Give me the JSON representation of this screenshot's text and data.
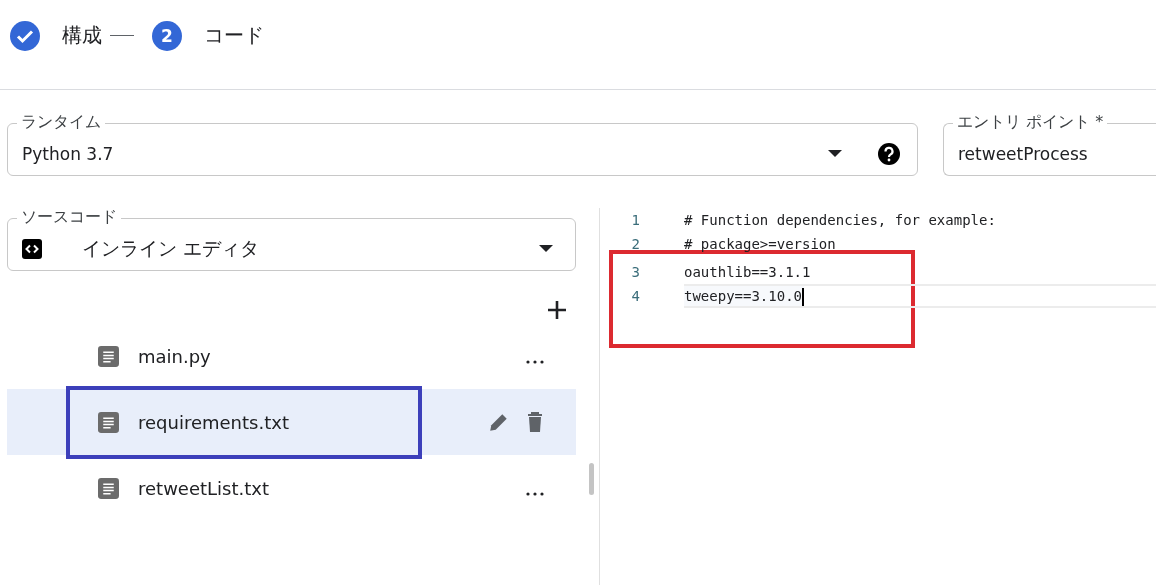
{
  "stepper": [
    {
      "label": "構成",
      "done": true
    },
    {
      "label": "コード",
      "done": false,
      "number": "2"
    }
  ],
  "runtime": {
    "label": "ランタイム",
    "value": "Python 3.7"
  },
  "entry_point": {
    "label": "エントリ ポイント *",
    "value": "retweetProcess"
  },
  "source_code": {
    "label": "ソースコード",
    "value": "インライン エディタ"
  },
  "files": [
    {
      "name": "main.py",
      "selected": false,
      "outlined": false
    },
    {
      "name": "requirements.txt",
      "selected": true,
      "outlined": true
    },
    {
      "name": "retweetList.txt",
      "selected": false,
      "outlined": false
    }
  ],
  "editor": {
    "lines": [
      {
        "number": "1",
        "text": "# Function dependencies, for example:",
        "boxed": false,
        "current": false
      },
      {
        "number": "2",
        "text": "# package>=version",
        "boxed": false,
        "current": false
      },
      {
        "number": "3",
        "text": "oauthlib==3.1.1",
        "boxed": true,
        "current": false
      },
      {
        "number": "4",
        "text": "tweepy==3.10.0",
        "boxed": true,
        "current": true
      }
    ]
  }
}
